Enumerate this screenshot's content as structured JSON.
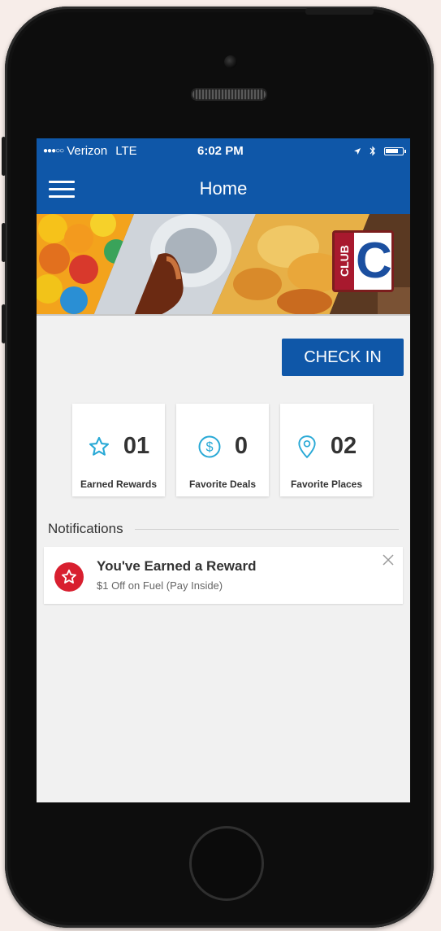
{
  "status_bar": {
    "signal": "●●●○○",
    "carrier": "Verizon",
    "network": "LTE",
    "time": "6:02 PM"
  },
  "nav": {
    "title": "Home",
    "menu_icon": "hamburger-menu-icon"
  },
  "banner": {
    "logo_side_text": "CLUB",
    "logo_letter": "C"
  },
  "check_in_label": "CHECK IN",
  "stats": [
    {
      "icon": "star-icon",
      "value": "01",
      "label": "Earned Rewards"
    },
    {
      "icon": "dollar-circle-icon",
      "value": "0",
      "label": "Favorite Deals"
    },
    {
      "icon": "location-pin-icon",
      "value": "02",
      "label": "Favorite Places"
    }
  ],
  "notifications": {
    "heading": "Notifications",
    "items": [
      {
        "icon": "star-icon",
        "title": "You've Earned a Reward",
        "subtitle": "$1 Off on Fuel (Pay Inside)"
      }
    ]
  },
  "colors": {
    "brand_blue": "#0f57a8",
    "accent_cyan": "#29a9d6",
    "alert_red": "#d81f2f"
  }
}
